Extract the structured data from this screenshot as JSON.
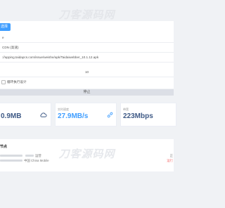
{
  "watermark": "刀客源码网",
  "config": {
    "tag": "选择",
    "row1": "e",
    "row2": "CDN (高速)",
    "url": "://apping.taidapcs.com/issue/weishe/apk/Taidaiwebber_10.1.12.apk",
    "row4": "",
    "threads": "10",
    "schedule_label": "循环执行设计"
  },
  "stop_button": "停止",
  "stats": {
    "total": {
      "label": "",
      "value": "0.9MB",
      "icon": "cloud-icon"
    },
    "speed": {
      "label": "实时速度",
      "value": "27.9MB/s",
      "icon": "link-icon"
    },
    "bandwidth": {
      "label": "带宽",
      "value": "223Mbps"
    }
  },
  "nodes": {
    "title": "节点",
    "rows": [
      {
        "text": "运营",
        "status": "正"
      },
      {
        "text": "中国 China Mobile",
        "status": "运行"
      }
    ]
  }
}
